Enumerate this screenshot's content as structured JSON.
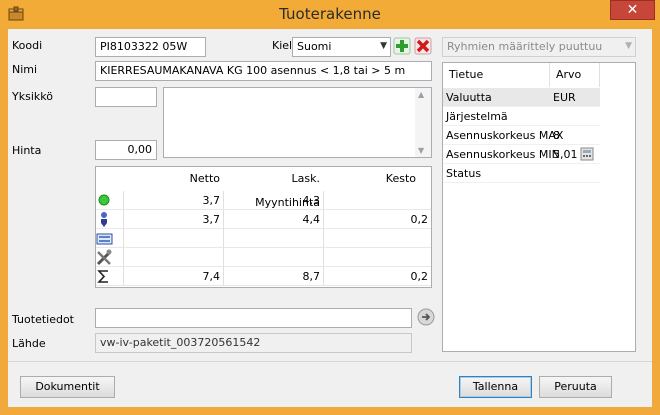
{
  "window": {
    "title": "Tuoterakenne",
    "close_glyph": "✕"
  },
  "labels": {
    "koodi": "Koodi",
    "kieli": "Kieli",
    "nimi": "Nimi",
    "yksikko": "Yksikkö",
    "hinta": "Hinta",
    "tuotetiedot": "Tuotetiedot",
    "lahde": "Lähde"
  },
  "fields": {
    "koodi": "PI8103322 05W",
    "kieli": "Suomi",
    "nimi": "KIERRESAUMAKANAVA KG 100 asennus < 1,8 tai > 5 m",
    "yksikko": "",
    "hinta": "0,00",
    "tuotetiedot": "",
    "lahde": "vw-iv-paketit_003720561542"
  },
  "group_select": {
    "value": "Ryhmien määrittely puuttuu"
  },
  "price_grid": {
    "headers": [
      "Netto",
      "Lask. Myyntihinta",
      "Kesto"
    ],
    "rows": [
      {
        "icon": "green-circle-icon",
        "values": [
          "3,7",
          "4,3",
          ""
        ]
      },
      {
        "icon": "worker-icon",
        "values": [
          "3,7",
          "4,4",
          "0,2"
        ]
      },
      {
        "icon": "keyboard-icon",
        "values": [
          "",
          "",
          ""
        ]
      },
      {
        "icon": "tools-icon",
        "values": [
          "",
          "",
          ""
        ]
      },
      {
        "icon": "sigma-icon",
        "values": [
          "7,4",
          "8,7",
          "0,2"
        ]
      }
    ]
  },
  "properties": {
    "headers": [
      "Tietue",
      "Arvo"
    ],
    "rows": [
      {
        "name": "Valuutta",
        "value": "EUR"
      },
      {
        "name": "Järjestelmä",
        "value": ""
      },
      {
        "name": "Asennuskorkeus MAX",
        "value": "8"
      },
      {
        "name": "Asennuskorkeus MIN",
        "value": "5,01"
      },
      {
        "name": "Status",
        "value": ""
      }
    ]
  },
  "buttons": {
    "dokumentit": "Dokumentit",
    "tallenna": "Tallenna",
    "peruuta": "Peruuta"
  },
  "colors": {
    "title_bar": "#f2ab37",
    "close": "#c7463a",
    "add": "#3aa93a",
    "delete": "#d02020"
  }
}
